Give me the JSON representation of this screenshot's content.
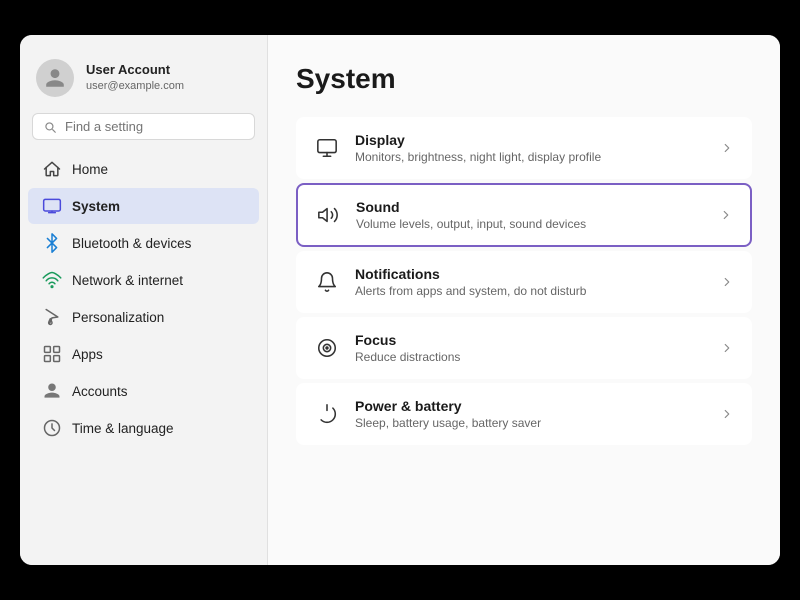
{
  "profile": {
    "name": "User Account",
    "email": "user@example.com"
  },
  "search": {
    "placeholder": "Find a setting"
  },
  "nav": {
    "items": [
      {
        "id": "home",
        "label": "Home",
        "icon": "home"
      },
      {
        "id": "system",
        "label": "System",
        "icon": "system",
        "active": true
      },
      {
        "id": "bluetooth",
        "label": "Bluetooth & devices",
        "icon": "bluetooth"
      },
      {
        "id": "network",
        "label": "Network & internet",
        "icon": "network"
      },
      {
        "id": "personalization",
        "label": "Personalization",
        "icon": "brush"
      },
      {
        "id": "apps",
        "label": "Apps",
        "icon": "apps"
      },
      {
        "id": "accounts",
        "label": "Accounts",
        "icon": "accounts"
      },
      {
        "id": "time",
        "label": "Time & language",
        "icon": "clock"
      }
    ]
  },
  "main": {
    "title": "System",
    "settings": [
      {
        "id": "display",
        "title": "Display",
        "desc": "Monitors, brightness, night light, display profile",
        "icon": "display",
        "highlighted": false
      },
      {
        "id": "sound",
        "title": "Sound",
        "desc": "Volume levels, output, input, sound devices",
        "icon": "sound",
        "highlighted": true
      },
      {
        "id": "notifications",
        "title": "Notifications",
        "desc": "Alerts from apps and system, do not disturb",
        "icon": "notifications",
        "highlighted": false
      },
      {
        "id": "focus",
        "title": "Focus",
        "desc": "Reduce distractions",
        "icon": "focus",
        "highlighted": false
      },
      {
        "id": "power",
        "title": "Power & battery",
        "desc": "Sleep, battery usage, battery saver",
        "icon": "power",
        "highlighted": false
      }
    ]
  }
}
